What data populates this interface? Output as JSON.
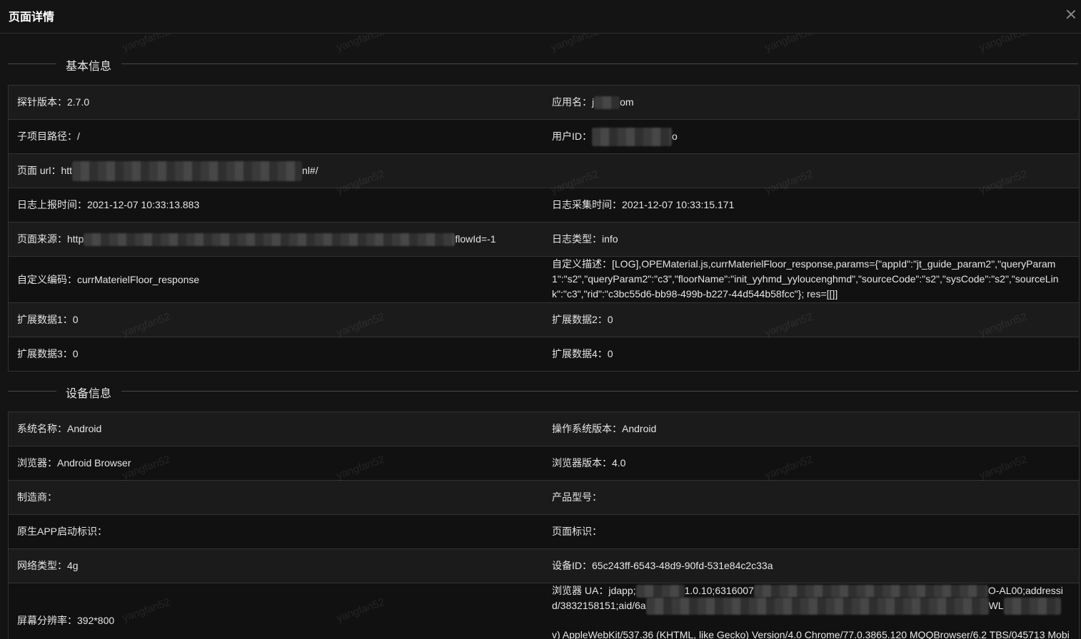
{
  "dialog": {
    "title": "页面详情"
  },
  "basic": {
    "section_title": "基本信息",
    "probe_version": {
      "label": "探针版本：",
      "value": "2.7.0"
    },
    "app_name": {
      "label": "应用名：",
      "value_a": "j",
      "value_b": "om"
    },
    "sub_path": {
      "label": "子项目路径：",
      "value": "/"
    },
    "user_id": {
      "label": "用户ID：",
      "value_b": "o"
    },
    "page_url": {
      "label": "页面 url：",
      "value_a": "htt",
      "value_b": "nl#/"
    },
    "report_time": {
      "label": "日志上报时间：",
      "value": "2021-12-07 10:33:13.883"
    },
    "collect_time": {
      "label": "日志采集时间：",
      "value": "2021-12-07 10:33:15.171"
    },
    "page_source": {
      "label": "页面来源：",
      "value_a": "http",
      "value_b": "flowId=-1"
    },
    "log_type": {
      "label": "日志类型：",
      "value": "info"
    },
    "custom_code": {
      "label": "自定义编码：",
      "value": "currMaterielFloor_response"
    },
    "custom_desc": {
      "label": "自定义描述：",
      "value": "[LOG],OPEMaterial.js,currMaterielFloor_response,params={\"appId\":\"jt_guide_param2\",\"queryParam1\":\"s2\",\"queryParam2\":\"c3\",\"floorName\":\"init_yyhmd_yyloucenghmd\",\"sourceCode\":\"s2\",\"sysCode\":\"s2\",\"sourceLink\":\"c3\",\"rid\":\"c3bc55d6-bb98-499b-b227-44d544b58fcc\"}; res=[[]]"
    },
    "ext1": {
      "label": "扩展数据1：",
      "value": "0"
    },
    "ext2": {
      "label": "扩展数据2：",
      "value": "0"
    },
    "ext3": {
      "label": "扩展数据3：",
      "value": "0"
    },
    "ext4": {
      "label": "扩展数据4：",
      "value": "0"
    }
  },
  "device": {
    "section_title": "设备信息",
    "os_name": {
      "label": "系统名称：",
      "value": "Android"
    },
    "os_version": {
      "label": "操作系统版本：",
      "value": "Android"
    },
    "browser": {
      "label": "浏览器：",
      "value": "Android Browser"
    },
    "browser_version": {
      "label": "浏览器版本：",
      "value": "4.0"
    },
    "manufacturer": {
      "label": "制造商：",
      "value": ""
    },
    "model": {
      "label": "产品型号：",
      "value": ""
    },
    "native_app": {
      "label": "原生APP启动标识：",
      "value": ""
    },
    "page_flag": {
      "label": "页面标识：",
      "value": ""
    },
    "network": {
      "label": "网络类型：",
      "value": "4g"
    },
    "device_id": {
      "label": "设备ID：",
      "value": "65c243ff-6543-48d9-90fd-531e84c2c33a"
    },
    "resolution": {
      "label": "屏幕分辨率：",
      "value": "392*800"
    },
    "ua": {
      "label": "浏览器 UA：",
      "line1_a": "jdapp;",
      "line1_b": "1.0.10;6316007",
      "line1_c": "O-AL00;addressi",
      "line2_a": "d/3832158151;aid/6a",
      "line2_b": "WL",
      "line3": "v) AppleWebKit/537.36 (KHTML, like Gecko) Version/4.0 Chrome/77.0.3865.120 MQQBrowser/6.2 TBS/045713 Mobi"
    }
  },
  "watermark": "yangfan52"
}
